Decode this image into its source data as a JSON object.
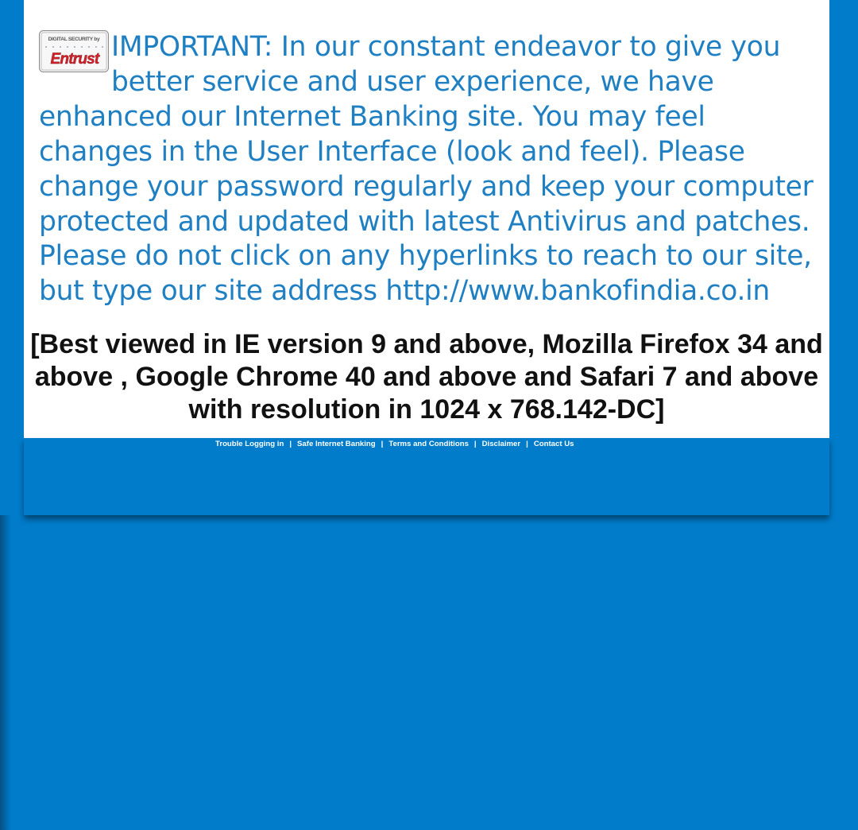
{
  "logo": {
    "icon": "entrust-digital-security-logo",
    "top_text": "DIGITAL SECURITY by",
    "brand": "Entrust"
  },
  "notice": {
    "text": "IMPORTANT: In our constant endeavor to give you better service and user experience, we have enhanced our Internet Banking site. You may feel changes in the User Interface (look and feel). Please change your password regularly and keep your computer protected and updated with latest Antivirus and patches. Please do not click on any hyperlinks to reach to our site, but type our site address http://www.bankofindia.co.in"
  },
  "browser_note": {
    "text": "[Best viewed in IE version 9 and above, Mozilla Firefox 34 and above , Google Chrome 40 and above and Safari 7 and above with resolution in 1024 x 768.142-DC]"
  },
  "footer": {
    "links": [
      "Trouble Logging in",
      "Safe Internet Banking",
      "Terms and Conditions",
      "Disclaimer",
      "Contact Us"
    ],
    "separator": "|"
  },
  "colors": {
    "page_background": "#007cca",
    "notice_text": "#1f7fc3",
    "panel": "#ffffff",
    "logo_red": "#d6202a"
  }
}
